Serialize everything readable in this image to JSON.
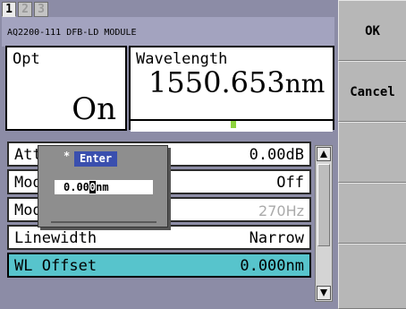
{
  "tabs": [
    "1",
    "2",
    "3"
  ],
  "active_tab": "1",
  "module_title": "AQ2200-111 DFB-LD MODULE",
  "opt": {
    "label": "Opt",
    "value": "On"
  },
  "wavelength": {
    "label": "Wavelength",
    "value": "1550.653",
    "unit": "nm"
  },
  "params": [
    {
      "label": "Att",
      "value": "0.00dB"
    },
    {
      "label": "Mod",
      "value": "Off"
    },
    {
      "label": "Mod Freq",
      "value": "270Hz"
    },
    {
      "label": "Linewidth",
      "value": "Narrow"
    },
    {
      "label": "WL Offset",
      "value": "0.000nm"
    }
  ],
  "enter_dialog": {
    "star": "*",
    "title": "Enter",
    "input_before_cursor": "0.00",
    "cursor_char": "0",
    "input_after_cursor": "nm"
  },
  "softkeys": [
    "OK",
    "Cancel",
    "",
    "",
    ""
  ],
  "colors": {
    "selected_row": "#57c4cc",
    "dialog_title": "#3a4fae",
    "marker": "#8dd33d"
  }
}
